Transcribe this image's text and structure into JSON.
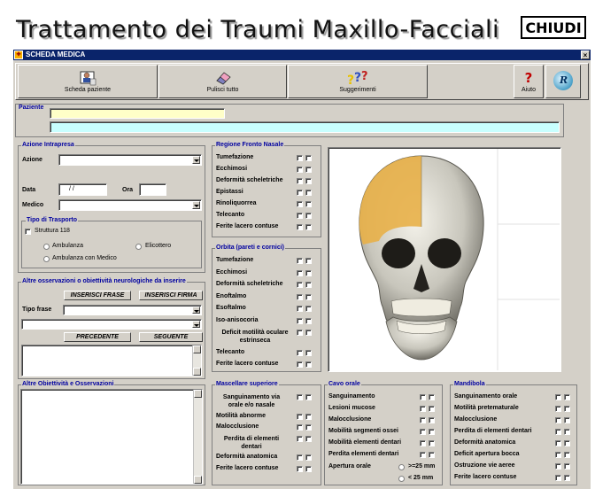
{
  "app_title": "Trattamento dei Traumi Maxillo-Facciali",
  "close_label": "CHIUDI",
  "window": {
    "title": "SCHEDA MEDICA",
    "close_glyph": "×"
  },
  "toolbar": {
    "scheda_paziente": "Scheda paziente",
    "pulisci_tutto": "Pulisci tutto",
    "suggerimenti": "Suggerimenti",
    "aiuto": "Aiuto",
    "aiuto_glyph": "?",
    "r_glyph": "R"
  },
  "paziente": {
    "label": "Paziente"
  },
  "azione": {
    "legend": "Azione Intrapresa",
    "azione_label": "Azione",
    "data_label": "Data",
    "data_value": "/  /",
    "ora_label": "Ora",
    "medico_label": "Medico",
    "trasporto_legend": "Tipo di Trasporto",
    "struttura": "Struttura 118",
    "ambulanza": "Ambulanza",
    "elicottero": "Elicottero",
    "ambulanza_medico": "Ambulanza con Medico"
  },
  "osservazioni": {
    "legend": "Altre osservazioni o obiettività neurologiche da inserire",
    "inserisci_frase": "INSERISCI FRASE",
    "inserisci_firma": "INSERISCI FIRMA",
    "tipo_frase": "Tipo frase",
    "precedente": "PRECEDENTE",
    "seguente": "SEGUENTE"
  },
  "altre": {
    "legend": "Altre Obiettività e Osservazioni"
  },
  "fronto_nasale": {
    "legend": "Regione Fronto Nasale",
    "items": [
      "Tumefazione",
      "Ecchimosi",
      "Deformità scheletriche",
      "Epistassi",
      "Rinoliquorrea",
      "Telecanto",
      "Ferite lacero contuse"
    ]
  },
  "orbita": {
    "legend": "Orbita  (pareti e cornici)",
    "items": [
      "Tumefazione",
      "Ecchimosi",
      "Deformità scheletriche",
      "Enoftalmo",
      "Esoftalmo",
      "Iso-anisocoria",
      "Deficit motilità oculare estrinseca",
      "Telecanto",
      "Ferite lacero contuse"
    ]
  },
  "mascellare": {
    "legend": "Mascellare superiore",
    "items": [
      "Sanguinamento via orale e/o nasale",
      "Motilità abnorme",
      "Malocclusione",
      "Perdita di elementi dentari",
      "Deformità anatomica",
      "Ferite lacero contuse"
    ]
  },
  "cavo_orale": {
    "legend": "Cavo orale",
    "items": [
      "Sanguinamento",
      "Lesioni mucose",
      "Malocclusione",
      "Mobilità segmenti ossei",
      "Mobilità elementi dentari",
      "Perdita elementi dentari"
    ],
    "apertura_label": "Apertura orale",
    "apertura_opt1": ">=25 mm",
    "apertura_opt2": "< 25 mm"
  },
  "mandibola": {
    "legend": "Mandibola",
    "items": [
      "Sanguinamento orale",
      "Motilità pretematurale",
      "Malocclusione",
      "Perdita di elementi dentari",
      "Deformità anatomica",
      "Deficit apertura bocca",
      "Ostruzione vie aeree",
      "Ferite lacero contuse"
    ]
  },
  "colors": {
    "highlight": "#e8b048",
    "yellow_field": "#ffffc8",
    "cyan_field": "#c8ffff",
    "legend": "#0000a0"
  }
}
